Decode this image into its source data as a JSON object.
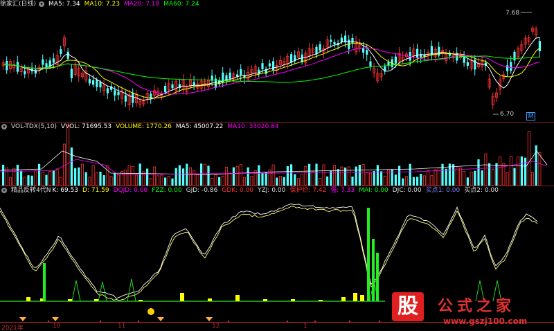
{
  "price_panel": {
    "stock_name": "徐家汇(日线)",
    "ma5": "MA5: 7.34",
    "ma10": "MA10: 7.23",
    "ma20": "MA20: 7.18",
    "ma60": "MA60: 7.24",
    "high_label": "7.68",
    "low_label": "6.70",
    "finance_badge": "财"
  },
  "volume_panel": {
    "name": "VOL-TDX(5,10)",
    "vvol": "VVOL: 71695.53",
    "volume": "VOLUME: 1770.26",
    "ma5": "MA5: 45007.22",
    "ma10": "MA10: 33020.84"
  },
  "indicator_panel": {
    "name": "精品反转4代N",
    "k": "K: 69.53",
    "d": "D: 71.59",
    "dqjd": "DQJD: 0.00",
    "fzz": "FZZ: 0.00",
    "gjd": "GJD: -0.86",
    "gdk": "GDK: 0.00",
    "yzj": "YZJ: 0.00",
    "protect": "保护价: 7.42",
    "strong": "强: 7.33",
    "mai": "MAI: 0.00",
    "djc": "DJC: 0.00",
    "buy1": "买点1: 0.00",
    "buy2": "买点2: 0.00"
  },
  "time_axis": {
    "year": "2021年",
    "m10": "10",
    "m11": "11",
    "m12": "12",
    "m1": "1"
  },
  "watermark": {
    "char": "股",
    "site_name": "公式之家",
    "url": "www.gszj100.com"
  },
  "colors": {
    "ma5": "#ffffff",
    "ma10": "#ffff00",
    "ma20": "#ff00ff",
    "ma60": "#00ff00",
    "up": "#ff3232",
    "down": "#54ffff",
    "protect": "#ff3232",
    "strong": "#ff00ff",
    "buy": "#8080ff"
  }
}
